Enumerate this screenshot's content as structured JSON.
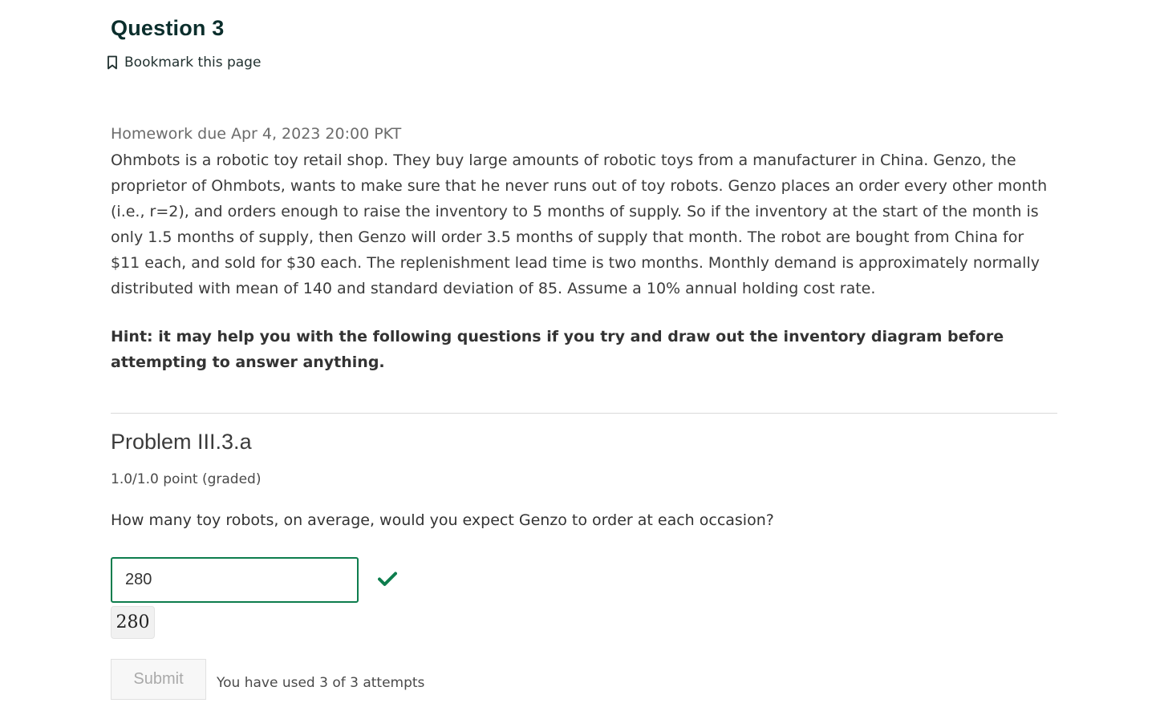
{
  "question": {
    "title": "Question 3",
    "bookmark_label": "Bookmark this page"
  },
  "homework": {
    "due": "Homework due Apr 4, 2023 20:00 PKT",
    "body": "Ohmbots is a robotic toy retail shop. They buy large amounts of robotic toys from a manufacturer in China. Genzo, the proprietor of Ohmbots, wants to make sure that he never runs out of toy robots. Genzo places an order every other month (i.e., r=2), and orders enough to raise the inventory to 5 months of supply. So if the inventory at the start of the month is only 1.5 months of supply, then Genzo will order 3.5 months of supply that month. The robot are bought from China for $11 each, and sold for $30 each. The replenishment lead time is two months. Monthly demand is approximately normally distributed with mean of 140 and standard deviation of 85. Assume a 10% annual holding cost rate.",
    "hint": "Hint: it may help you with the following questions if you try and draw out the inventory diagram before attempting to answer anything."
  },
  "problem": {
    "title": "Problem III.3.a",
    "points": "1.0/1.0 point (graded)",
    "question_text": "How many toy robots, on average, would you expect Genzo to order at each occasion?",
    "answer_value": "280",
    "answer_preview": "280",
    "status": "correct",
    "submit_label": "Submit",
    "attempts_text": "You have used 3 of 3 attempts"
  },
  "colors": {
    "heading": "#0b2e2c",
    "correct_green": "#0d7d4d",
    "body_text": "#3b3b3b",
    "muted_text": "#6b6b6b",
    "disabled_text": "#a9a9a9"
  },
  "icons": {
    "bookmark": "bookmark-outline-icon",
    "status": "checkmark-icon"
  }
}
